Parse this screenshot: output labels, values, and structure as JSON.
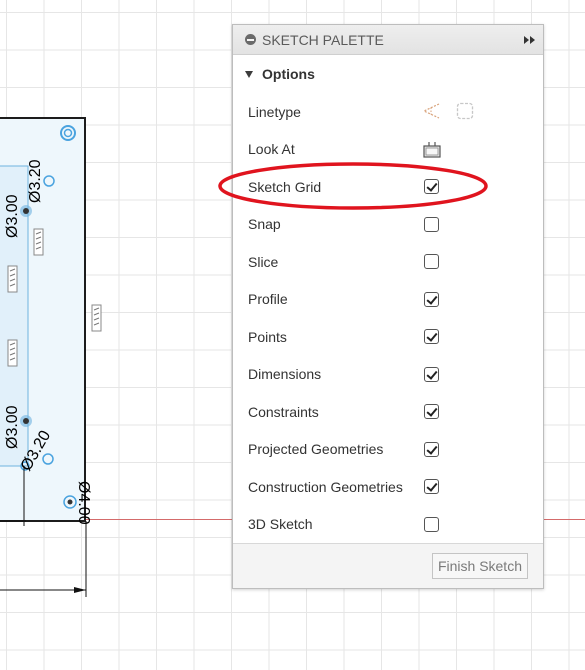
{
  "canvas": {
    "dimensions": [
      "Ø3.00",
      "Ø3.20",
      "Ø3.00",
      "Ø3.20",
      "Ø4.00"
    ]
  },
  "palette": {
    "title": "SKETCH PALETTE",
    "section_title": "Options",
    "rows": [
      {
        "label": "Linetype",
        "control": "linetype"
      },
      {
        "label": "Look At",
        "control": "lookat"
      },
      {
        "label": "Sketch Grid",
        "control": "checkbox",
        "checked": true
      },
      {
        "label": "Snap",
        "control": "checkbox",
        "checked": false
      },
      {
        "label": "Slice",
        "control": "checkbox",
        "checked": false
      },
      {
        "label": "Profile",
        "control": "checkbox",
        "checked": true
      },
      {
        "label": "Points",
        "control": "checkbox",
        "checked": true
      },
      {
        "label": "Dimensions",
        "control": "checkbox",
        "checked": true
      },
      {
        "label": "Constraints",
        "control": "checkbox",
        "checked": true
      },
      {
        "label": "Projected Geometries",
        "control": "checkbox",
        "checked": true
      },
      {
        "label": "Construction Geometries",
        "control": "checkbox",
        "checked": true
      },
      {
        "label": "3D Sketch",
        "control": "checkbox",
        "checked": false
      }
    ],
    "finish_label": "Finish Sketch"
  },
  "colors": {
    "highlight_ellipse": "#e0141e",
    "sketch_line": "#1c1c1c",
    "sketch_fill": "#eef7fc",
    "axis_red": "#d46b6b"
  },
  "icons": [
    "minus-circle-icon",
    "expand-arrows-icon",
    "caret-down-icon",
    "linetype-construction-icon",
    "linetype-centerline-icon",
    "look-at-icon"
  ]
}
